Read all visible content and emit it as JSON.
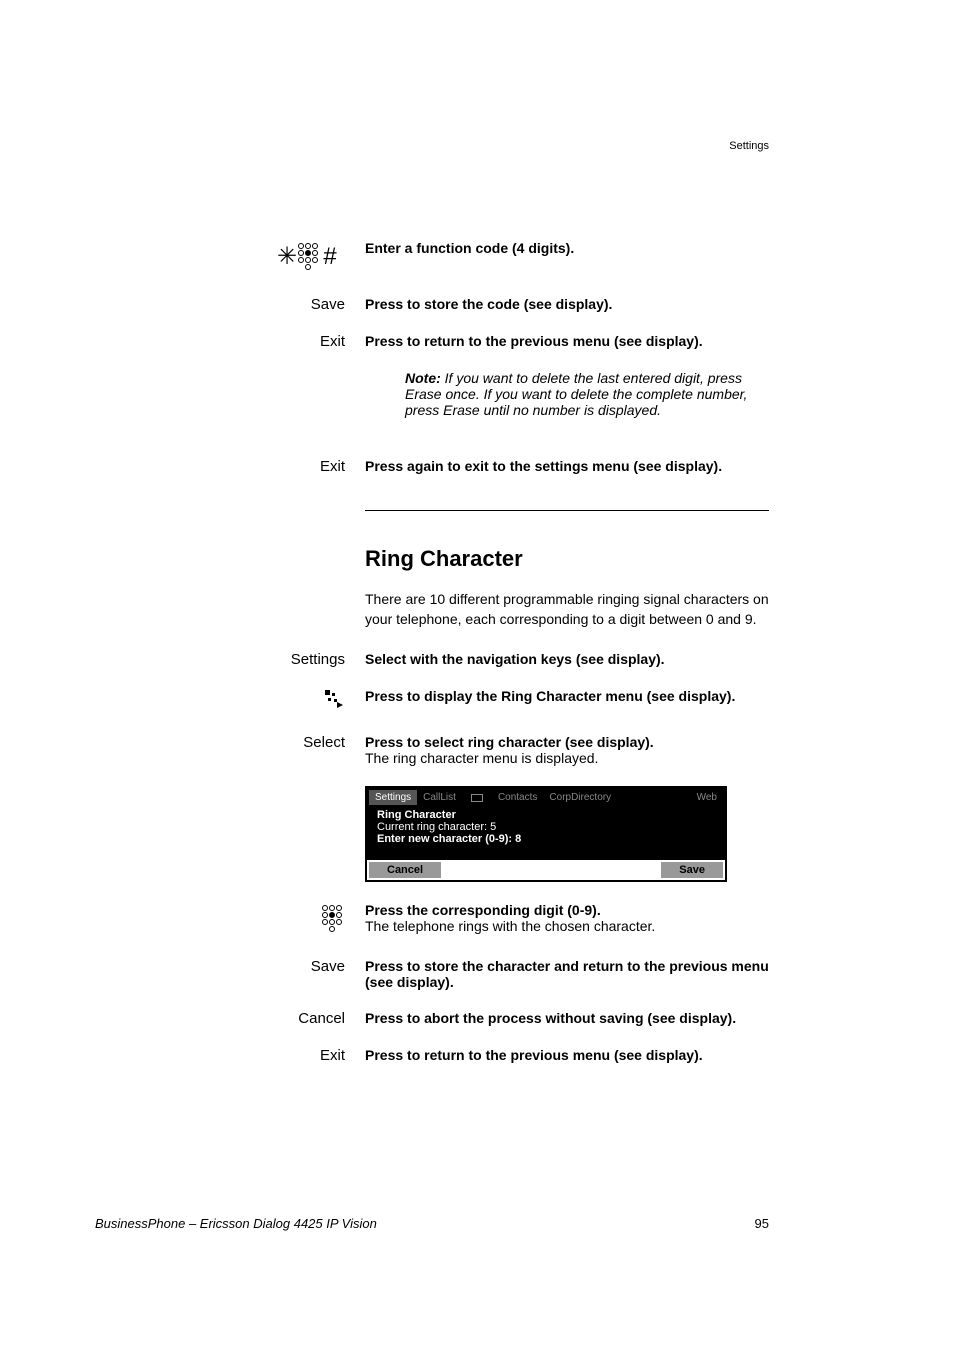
{
  "header": {
    "right": "Settings"
  },
  "rows": {
    "keypad": {
      "text": "Enter a function code (4 digits)."
    },
    "save1": {
      "label": "Save",
      "text": "Press to store the code (see display)."
    },
    "exit1": {
      "label": "Exit",
      "text": "Press to return to the previous menu (see display)."
    },
    "note": {
      "bold": "Note:",
      "text": " If you want to delete the last entered digit, press Erase once. If you want to delete the complete number, press Erase until no number is displayed."
    },
    "exit2": {
      "label": "Exit",
      "text": "Press again to exit to the settings menu (see display)."
    },
    "section_title": "Ring Character",
    "section_intro": "There are 10 different programmable ringing signal characters on your telephone, each corresponding to a digit between 0 and 9.",
    "settings": {
      "label": "Settings",
      "text": "Select with the navigation keys (see display)."
    },
    "navicon": {
      "text": "Press to display the Ring Character menu (see display)."
    },
    "select": {
      "label": "Select",
      "text": "Press to select ring character (see display).",
      "subtext": "The ring character menu is displayed."
    },
    "keypad2": {
      "text": "Press the corresponding digit (0-9).",
      "subtext": "The telephone rings with the chosen character."
    },
    "save2": {
      "label": "Save",
      "text": "Press to store the character and return to the previous menu (see display)."
    },
    "cancel": {
      "label": "Cancel",
      "text": "Press to abort the process without saving (see display)."
    },
    "exit3": {
      "label": "Exit",
      "text": "Press to return to the previous menu (see display)."
    }
  },
  "chart_data": {
    "type": "table",
    "title": "Ring Character Phone Display",
    "tabs": [
      "Settings",
      "CallList",
      "",
      "Contacts",
      "CorpDirectory",
      "Web"
    ],
    "active_tab": "Settings",
    "body_title": "Ring Character",
    "body_lines": [
      {
        "text": "Current ring character: 5",
        "bold": false
      },
      {
        "text": "Enter new character (0-9): 8",
        "bold": true
      }
    ],
    "footer_left": "Cancel",
    "footer_right": "Save"
  },
  "footer": {
    "left": "BusinessPhone – Ericsson Dialog 4425 IP Vision",
    "right": "95"
  }
}
